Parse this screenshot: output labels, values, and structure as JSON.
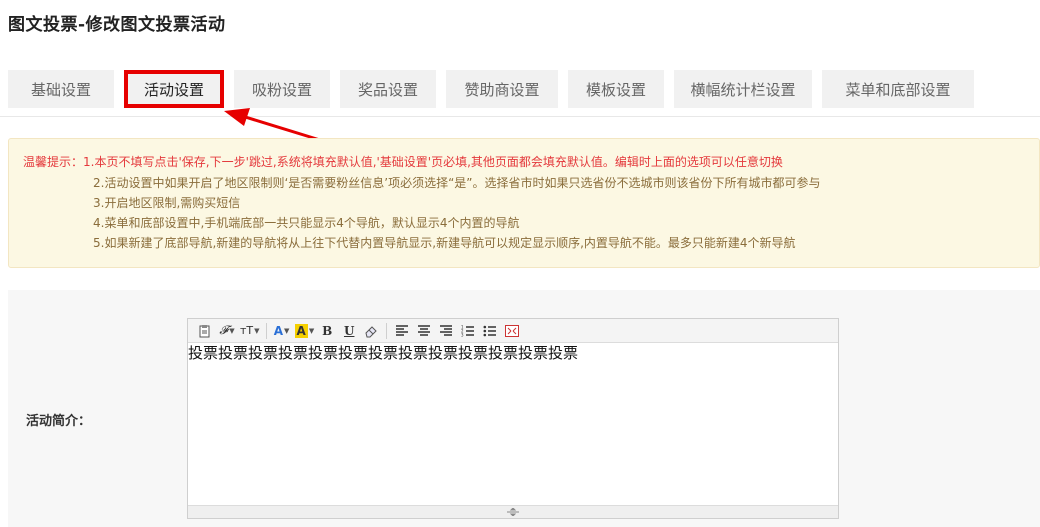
{
  "page": {
    "title": "图文投票-修改图文投票活动"
  },
  "tabs": [
    {
      "label": "基础设置",
      "active": false
    },
    {
      "label": "活动设置",
      "active": true
    },
    {
      "label": "吸粉设置",
      "active": false
    },
    {
      "label": "奖品设置",
      "active": false
    },
    {
      "label": "赞助商设置",
      "active": false
    },
    {
      "label": "模板设置",
      "active": false
    },
    {
      "label": "横幅统计栏设置",
      "active": false
    },
    {
      "label": "菜单和底部设置",
      "active": false
    }
  ],
  "notice": {
    "prefix": "温馨提示：",
    "lines": [
      "1.本页不填写点击'保存,下一步'跳过,系统将填充默认值,'基础设置'页必填,其他页面都会填充默认值。编辑时上面的选项可以任意切换",
      "2.活动设置中如果开启了地区限制则‘是否需要粉丝信息’项必须选择“是”。选择省市时如果只选省份不选城市则该省份下所有城市都可参与",
      "3.开启地区限制,需购买短信",
      "4.菜单和底部设置中,手机端底部一共只能显示4个导航，默认显示4个内置的导航",
      "5.如果新建了底部导航,新建的导航将从上往下代替内置导航显示,新建导航可以规定显示顺序,内置导航不能。最多只能新建4个新导航"
    ]
  },
  "form": {
    "intro_label": "活动简介：",
    "intro_value": "投票投票投票投票投票投票投票投票投票投票投票投票投票"
  },
  "toolbar": {
    "font_family": "𝓕",
    "font_size": "тT",
    "font_color": "A",
    "highlight": "A",
    "bold": "B",
    "underline": "U"
  },
  "colors": {
    "highlight_red": "#e60000",
    "notice_bg": "#fcf8e3",
    "notice_red": "#e4393c",
    "notice_brown": "#8a6d3b"
  }
}
